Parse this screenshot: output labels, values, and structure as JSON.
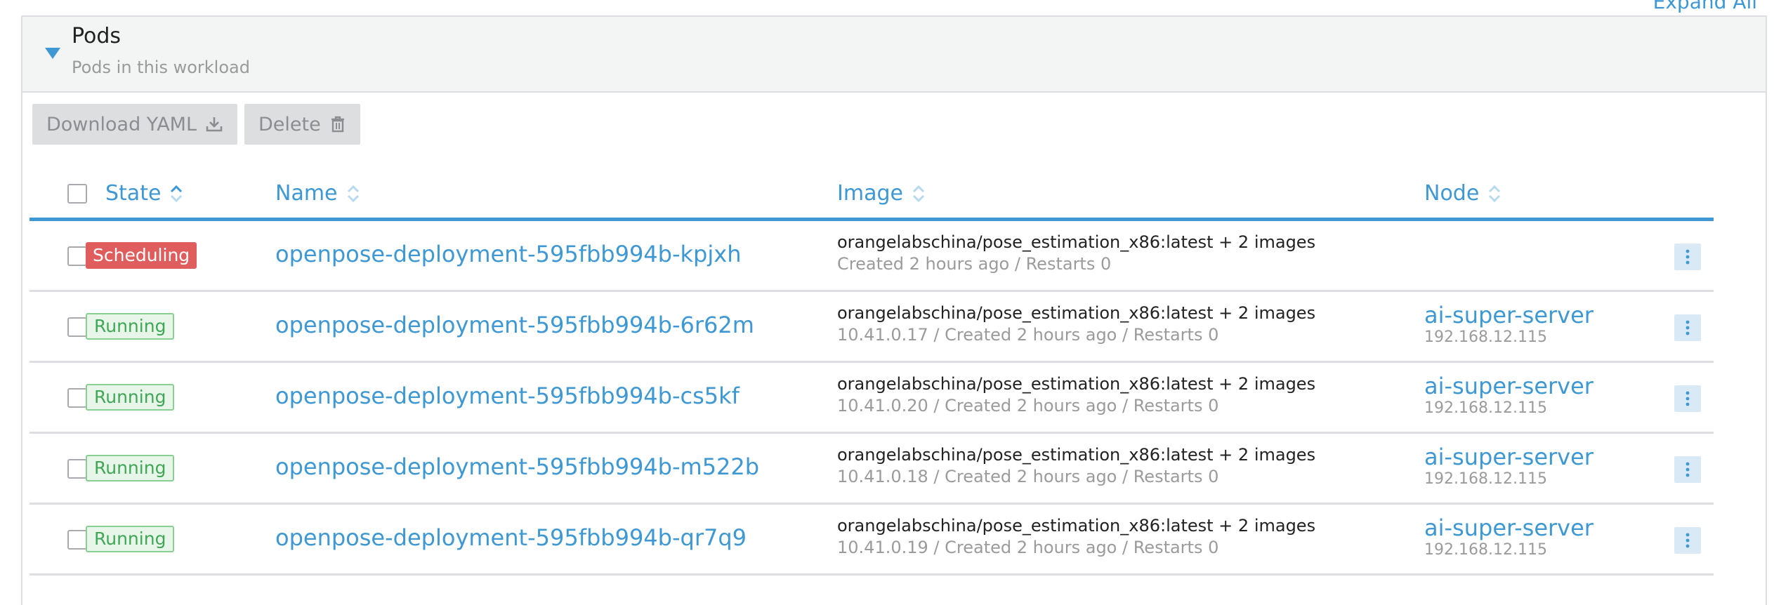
{
  "header": {
    "expand_all": "Expand All",
    "title": "Pods",
    "subtitle": "Pods in this workload"
  },
  "toolbar": {
    "download_label": "Download YAML",
    "delete_label": "Delete"
  },
  "table": {
    "columns": {
      "state": "State",
      "name": "Name",
      "image": "Image",
      "node": "Node"
    },
    "rows": [
      {
        "state": "Scheduling",
        "name": "openpose-deployment-595fbb994b-kpjxh",
        "image": "orangelabschina/pose_estimation_x86:latest + 2 images",
        "details": "Created 2 hours ago / Restarts 0",
        "node": "",
        "node_ip": ""
      },
      {
        "state": "Running",
        "name": "openpose-deployment-595fbb994b-6r62m",
        "image": "orangelabschina/pose_estimation_x86:latest + 2 images",
        "details": "10.41.0.17 / Created 2 hours ago / Restarts 0",
        "node": "ai-super-server",
        "node_ip": "192.168.12.115"
      },
      {
        "state": "Running",
        "name": "openpose-deployment-595fbb994b-cs5kf",
        "image": "orangelabschina/pose_estimation_x86:latest + 2 images",
        "details": "10.41.0.20 / Created 2 hours ago / Restarts 0",
        "node": "ai-super-server",
        "node_ip": "192.168.12.115"
      },
      {
        "state": "Running",
        "name": "openpose-deployment-595fbb994b-m522b",
        "image": "orangelabschina/pose_estimation_x86:latest + 2 images",
        "details": "10.41.0.18 / Created 2 hours ago / Restarts 0",
        "node": "ai-super-server",
        "node_ip": "192.168.12.115"
      },
      {
        "state": "Running",
        "name": "openpose-deployment-595fbb994b-qr7q9",
        "image": "orangelabschina/pose_estimation_x86:latest + 2 images",
        "details": "10.41.0.19 / Created 2 hours ago / Restarts 0",
        "node": "ai-super-server",
        "node_ip": "192.168.12.115"
      }
    ]
  },
  "icons": {
    "download": "download-icon",
    "delete": "trash-icon",
    "sort": "sort-icon",
    "menu": "kebab-menu-icon",
    "collapse": "caret-down-icon"
  },
  "colors": {
    "accent": "#3d98d3",
    "scheduling": "#e05d5d",
    "running": "#3fa756"
  }
}
